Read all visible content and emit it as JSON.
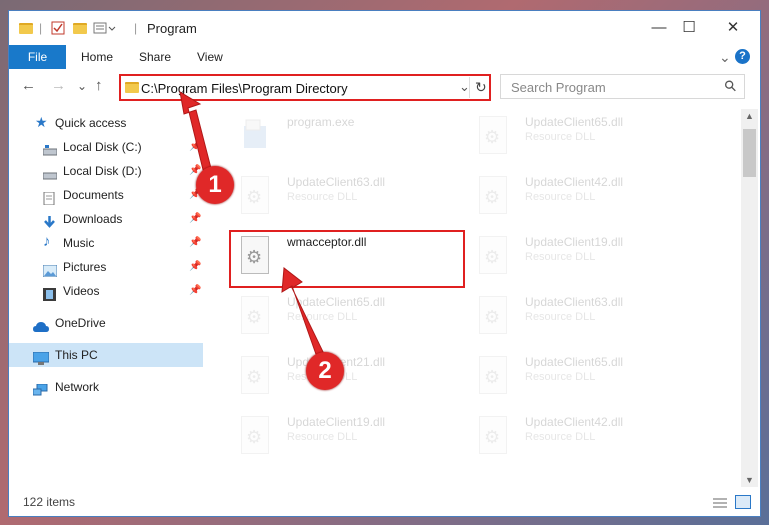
{
  "window": {
    "title": "Program",
    "controls": {
      "minimize": "—",
      "maximize": "☐",
      "close": "✕"
    }
  },
  "ribbon": {
    "tabs": [
      {
        "label": "File"
      },
      {
        "label": "Home"
      },
      {
        "label": "Share"
      },
      {
        "label": "View"
      }
    ],
    "expand": "⌄",
    "help": "?"
  },
  "navigation": {
    "back": "←",
    "forward": "→",
    "recent": "⌄",
    "up": "↑",
    "address": "C:\\Program Files\\Program Directory",
    "dropdown": "⌄",
    "refresh": "↻",
    "search_placeholder": "Search Program",
    "search_icon": "⚲"
  },
  "sidebar": {
    "items": [
      {
        "label": "Quick access",
        "icon": "star-icon",
        "pinned": false
      },
      {
        "label": "Local Disk (C:)",
        "icon": "drive-icon",
        "pinned": true
      },
      {
        "label": "Local Disk (D:)",
        "icon": "drive-icon",
        "pinned": true
      },
      {
        "label": "Documents",
        "icon": "documents-icon",
        "pinned": true
      },
      {
        "label": "Downloads",
        "icon": "download-icon",
        "pinned": true
      },
      {
        "label": "Music",
        "icon": "music-icon",
        "pinned": true
      },
      {
        "label": "Pictures",
        "icon": "pictures-icon",
        "pinned": true
      },
      {
        "label": "Videos",
        "icon": "videos-icon",
        "pinned": true
      },
      {
        "label": "OneDrive",
        "icon": "cloud-icon",
        "pinned": false
      },
      {
        "label": "This PC",
        "icon": "computer-icon",
        "pinned": false,
        "selected": true
      },
      {
        "label": "Network",
        "icon": "network-icon",
        "pinned": false
      }
    ],
    "pin_glyph": "📌"
  },
  "files": [
    {
      "name": "program.exe",
      "desc": "",
      "faded": true
    },
    {
      "name": "UpdateClient65.dll",
      "desc": "Resource DLL",
      "faded": true
    },
    {
      "name": "UpdateClient63.dll",
      "desc": "Resource DLL",
      "faded": true
    },
    {
      "name": "UpdateClient42.dll",
      "desc": "Resource DLL",
      "faded": true
    },
    {
      "name": "wmacceptor.dll",
      "desc": "",
      "faded": false
    },
    {
      "name": "UpdateClient19.dll",
      "desc": "Resource DLL",
      "faded": true
    },
    {
      "name": "UpdateClient65.dll",
      "desc": "Resource DLL",
      "faded": true
    },
    {
      "name": "UpdateClient63.dll",
      "desc": "Resource DLL",
      "faded": true
    },
    {
      "name": "UpdateClient21.dll",
      "desc": "Resource DLL",
      "faded": true
    },
    {
      "name": "UpdateClient65.dll",
      "desc": "Resource DLL",
      "faded": true
    },
    {
      "name": "UpdateClient19.dll",
      "desc": "Resource DLL",
      "faded": true
    },
    {
      "name": "UpdateClient42.dll",
      "desc": "Resource DLL",
      "faded": true
    }
  ],
  "status": {
    "item_count": "122 items"
  },
  "annotations": {
    "step1": "1",
    "step2": "2",
    "color": "#e02828"
  }
}
